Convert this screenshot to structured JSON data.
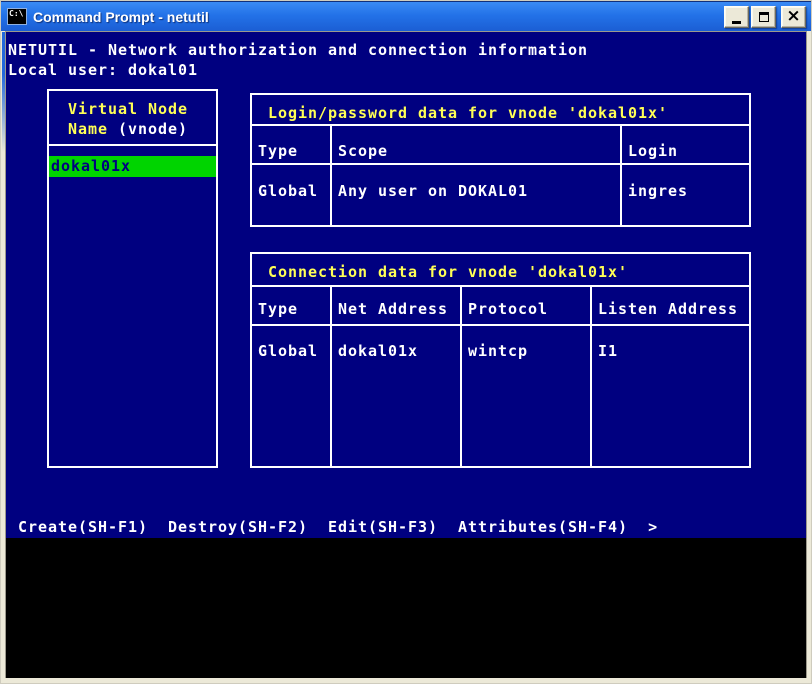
{
  "window": {
    "title": "Command Prompt - netutil",
    "icon_text": "C:\\",
    "controls": {
      "close_glyph": "×"
    }
  },
  "console": {
    "header_line": "NETUTIL - Network authorization and connection information",
    "local_user_label": "Local user: dokal01",
    "vnode_panel": {
      "title_line1": "Virtual Node",
      "title_line2_yellow": "Name",
      "title_line2_white": "(vnode)",
      "selected_vnode": "dokal01x"
    },
    "login_table": {
      "title": "Login/password data for vnode 'dokal01x'",
      "headers": [
        "Type",
        "Scope",
        "Login"
      ],
      "rows": [
        [
          "Global",
          "Any user on DOKAL01",
          "ingres"
        ]
      ]
    },
    "connection_table": {
      "title": "Connection data for vnode 'dokal01x'",
      "headers": [
        "Type",
        "Net Address",
        "Protocol",
        "Listen Address"
      ],
      "rows": [
        [
          "Global",
          "dokal01x",
          "wintcp",
          "I1"
        ]
      ]
    },
    "menu": {
      "items": [
        "Create(SH-F1)",
        "Destroy(SH-F2)",
        "Edit(SH-F3)",
        "Attributes(SH-F4)"
      ],
      "more_indicator": ">"
    },
    "colors": {
      "console_bg": "#000080",
      "accent_yellow": "#ffff55",
      "selection_green": "#00d400",
      "selection_text": "#000080",
      "text_white": "#ffffff",
      "titlebar_blue": "#2372e8",
      "frame_beige": "#ece9d8"
    }
  }
}
